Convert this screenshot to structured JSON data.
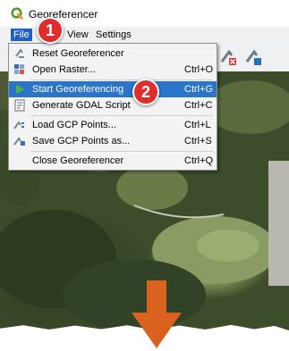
{
  "window": {
    "title": "Georeferencer"
  },
  "menubar": {
    "file": "File",
    "view": "View",
    "settings": "Settings"
  },
  "file_menu": {
    "items": [
      {
        "label": "Reset Georeferencer",
        "shortcut": "",
        "icon": "reset-icon"
      },
      {
        "label": "Open Raster...",
        "shortcut": "Ctrl+O",
        "icon": "open-raster-icon"
      },
      {
        "label": "Start Georeferencing",
        "shortcut": "Ctrl+G",
        "icon": "play-icon",
        "highlighted": true
      },
      {
        "label": "Generate GDAL Script",
        "shortcut": "Ctrl+C",
        "icon": "script-icon"
      },
      {
        "label": "Load GCP Points...",
        "shortcut": "Ctrl+L",
        "icon": "load-gcp-icon"
      },
      {
        "label": "Save GCP Points as...",
        "shortcut": "Ctrl+S",
        "icon": "save-gcp-icon"
      },
      {
        "label": "Close Georeferencer",
        "shortcut": "Ctrl+Q",
        "icon": ""
      }
    ]
  },
  "annotations": {
    "step1": "1",
    "step2": "2"
  },
  "colors": {
    "highlight": "#2a74c9",
    "badge": "#e02c2c",
    "arrow": "#d9631e",
    "qgis_green": "#589632"
  }
}
